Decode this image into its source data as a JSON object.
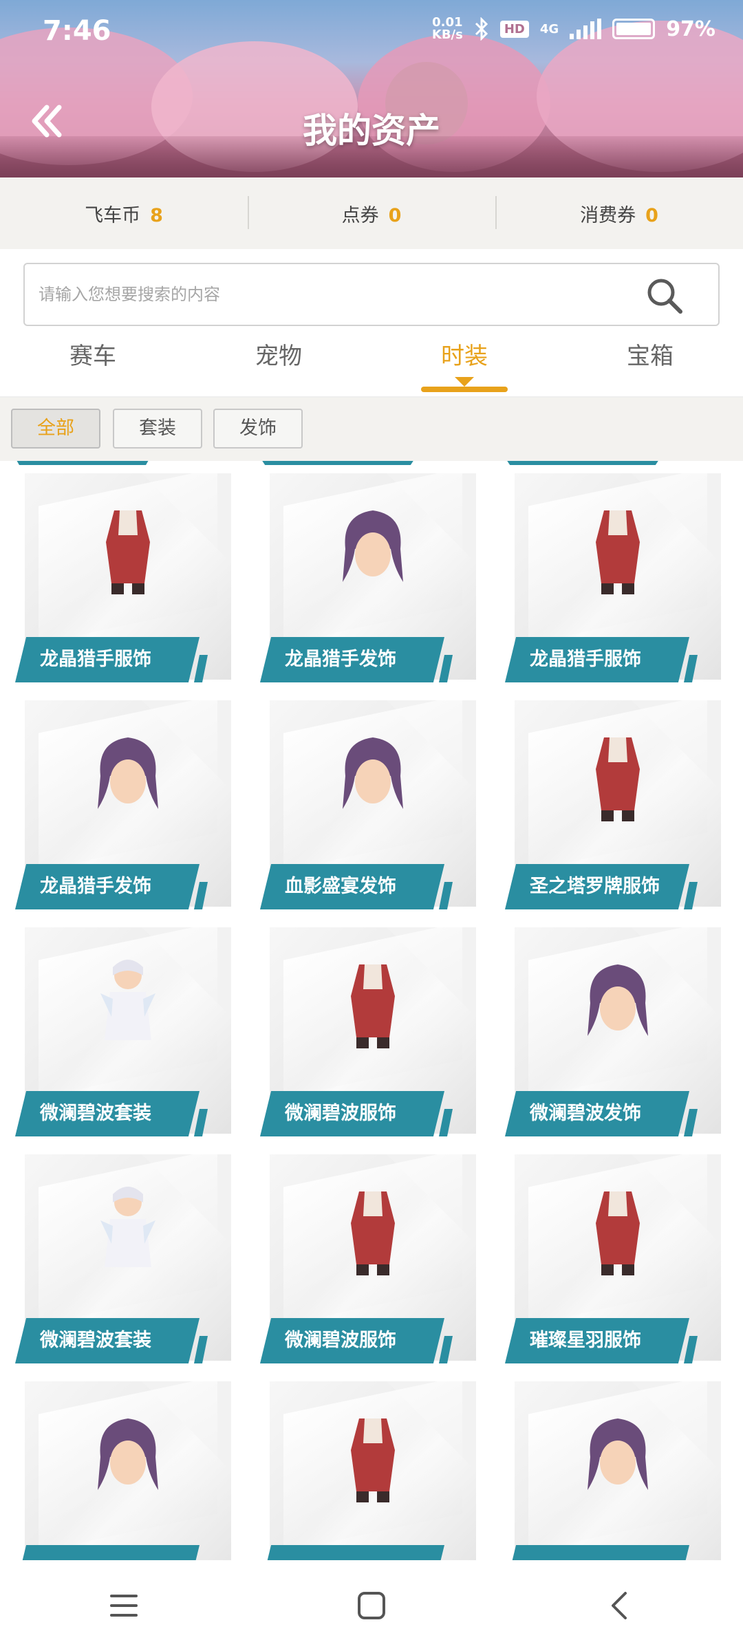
{
  "status_bar": {
    "time": "7:46",
    "net_speed_value": "0.01",
    "net_speed_unit": "KB/s",
    "hd": "HD",
    "network": "4G",
    "battery": "97%"
  },
  "header": {
    "title": "我的资产",
    "back_icon": "double-chevron-left-icon"
  },
  "currencies": [
    {
      "label": "飞车币",
      "value": "8"
    },
    {
      "label": "点券",
      "value": "0"
    },
    {
      "label": "消费券",
      "value": "0"
    }
  ],
  "search": {
    "placeholder": "请输入您想要搜索的内容",
    "icon": "search-icon"
  },
  "tabs": [
    {
      "label": "赛车",
      "active": false
    },
    {
      "label": "宠物",
      "active": false
    },
    {
      "label": "时装",
      "active": true
    },
    {
      "label": "宝箱",
      "active": false
    }
  ],
  "filters": [
    {
      "label": "全部",
      "active": true
    },
    {
      "label": "套装",
      "active": false
    },
    {
      "label": "发饰",
      "active": false
    }
  ],
  "items": [
    {
      "label": "龙晶猎手服饰",
      "kind": "outfit"
    },
    {
      "label": "龙晶猎手发饰",
      "kind": "hair"
    },
    {
      "label": "龙晶猎手服饰",
      "kind": "outfit"
    },
    {
      "label": "龙晶猎手发饰",
      "kind": "hair"
    },
    {
      "label": "血影盛宴发饰",
      "kind": "hair"
    },
    {
      "label": "圣之塔罗牌服饰",
      "kind": "outfit"
    },
    {
      "label": "微澜碧波套装",
      "kind": "suit"
    },
    {
      "label": "微澜碧波服饰",
      "kind": "outfit"
    },
    {
      "label": "微澜碧波发饰",
      "kind": "hair"
    },
    {
      "label": "微澜碧波套装",
      "kind": "suit"
    },
    {
      "label": "微澜碧波服饰",
      "kind": "outfit"
    },
    {
      "label": "璀璨星羽服饰",
      "kind": "outfit"
    },
    {
      "label": "",
      "kind": "hair"
    },
    {
      "label": "",
      "kind": "outfit"
    },
    {
      "label": "",
      "kind": "hair"
    }
  ],
  "colors": {
    "accent": "#e8a21b",
    "label_teal": "#2a8ea1"
  },
  "nav": {
    "menu_icon": "menu-icon",
    "home_icon": "home-square-icon",
    "back_icon": "back-chevron-icon"
  }
}
